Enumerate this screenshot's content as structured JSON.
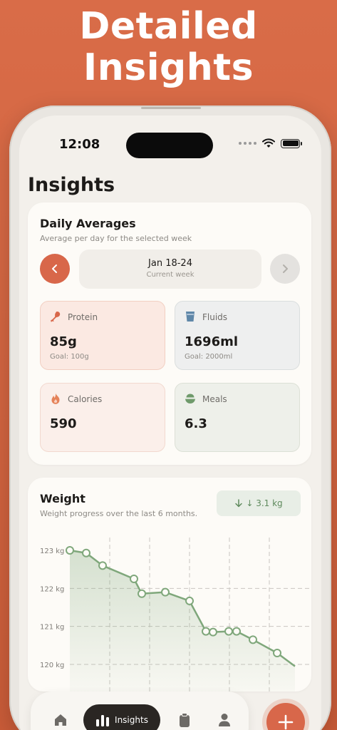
{
  "headline": {
    "line1": "Detailed",
    "line2": "Insights"
  },
  "status_bar": {
    "time": "12:08"
  },
  "page": {
    "title": "Insights"
  },
  "daily_averages": {
    "title": "Daily Averages",
    "subtitle": "Average per day for the selected week",
    "week_range": "Jan 18-24",
    "week_label": "Current week",
    "stats": {
      "protein": {
        "label": "Protein",
        "value": "85g",
        "goal": "Goal: 100g",
        "icon": "drumstick-icon",
        "color": "#d8674a"
      },
      "fluids": {
        "label": "Fluids",
        "value": "1696ml",
        "goal": "Goal: 2000ml",
        "icon": "cup-icon",
        "color": "#5f87a8"
      },
      "calories": {
        "label": "Calories",
        "value": "590",
        "icon": "flame-icon",
        "color": "#e58259"
      },
      "meals": {
        "label": "Meals",
        "value": "6.3",
        "icon": "bowl-icon",
        "color": "#6f9a6b"
      }
    }
  },
  "weight": {
    "title": "Weight",
    "subtitle": "Weight progress over the last 6 months.",
    "change": "↓ 3.1 kg",
    "accent": "#7fa77b"
  },
  "chart_data": {
    "type": "area",
    "title": "Weight",
    "ylabel": "",
    "xlabel": "",
    "y_ticks": [
      "123 kg",
      "122 kg",
      "121 kg",
      "120 kg"
    ],
    "ylim": [
      119.8,
      123.1
    ],
    "grid": true,
    "series": [
      {
        "values": [
          123.0,
          122.93,
          122.6,
          122.25,
          121.86,
          121.9,
          121.67,
          120.87,
          120.85,
          120.87,
          120.87,
          120.65,
          120.3,
          119.95
        ]
      }
    ]
  },
  "tabbar": {
    "insights_label": "Insights"
  },
  "colors": {
    "background": "#d96c48",
    "accent": "#d8674a",
    "card": "#fdfbf7"
  }
}
